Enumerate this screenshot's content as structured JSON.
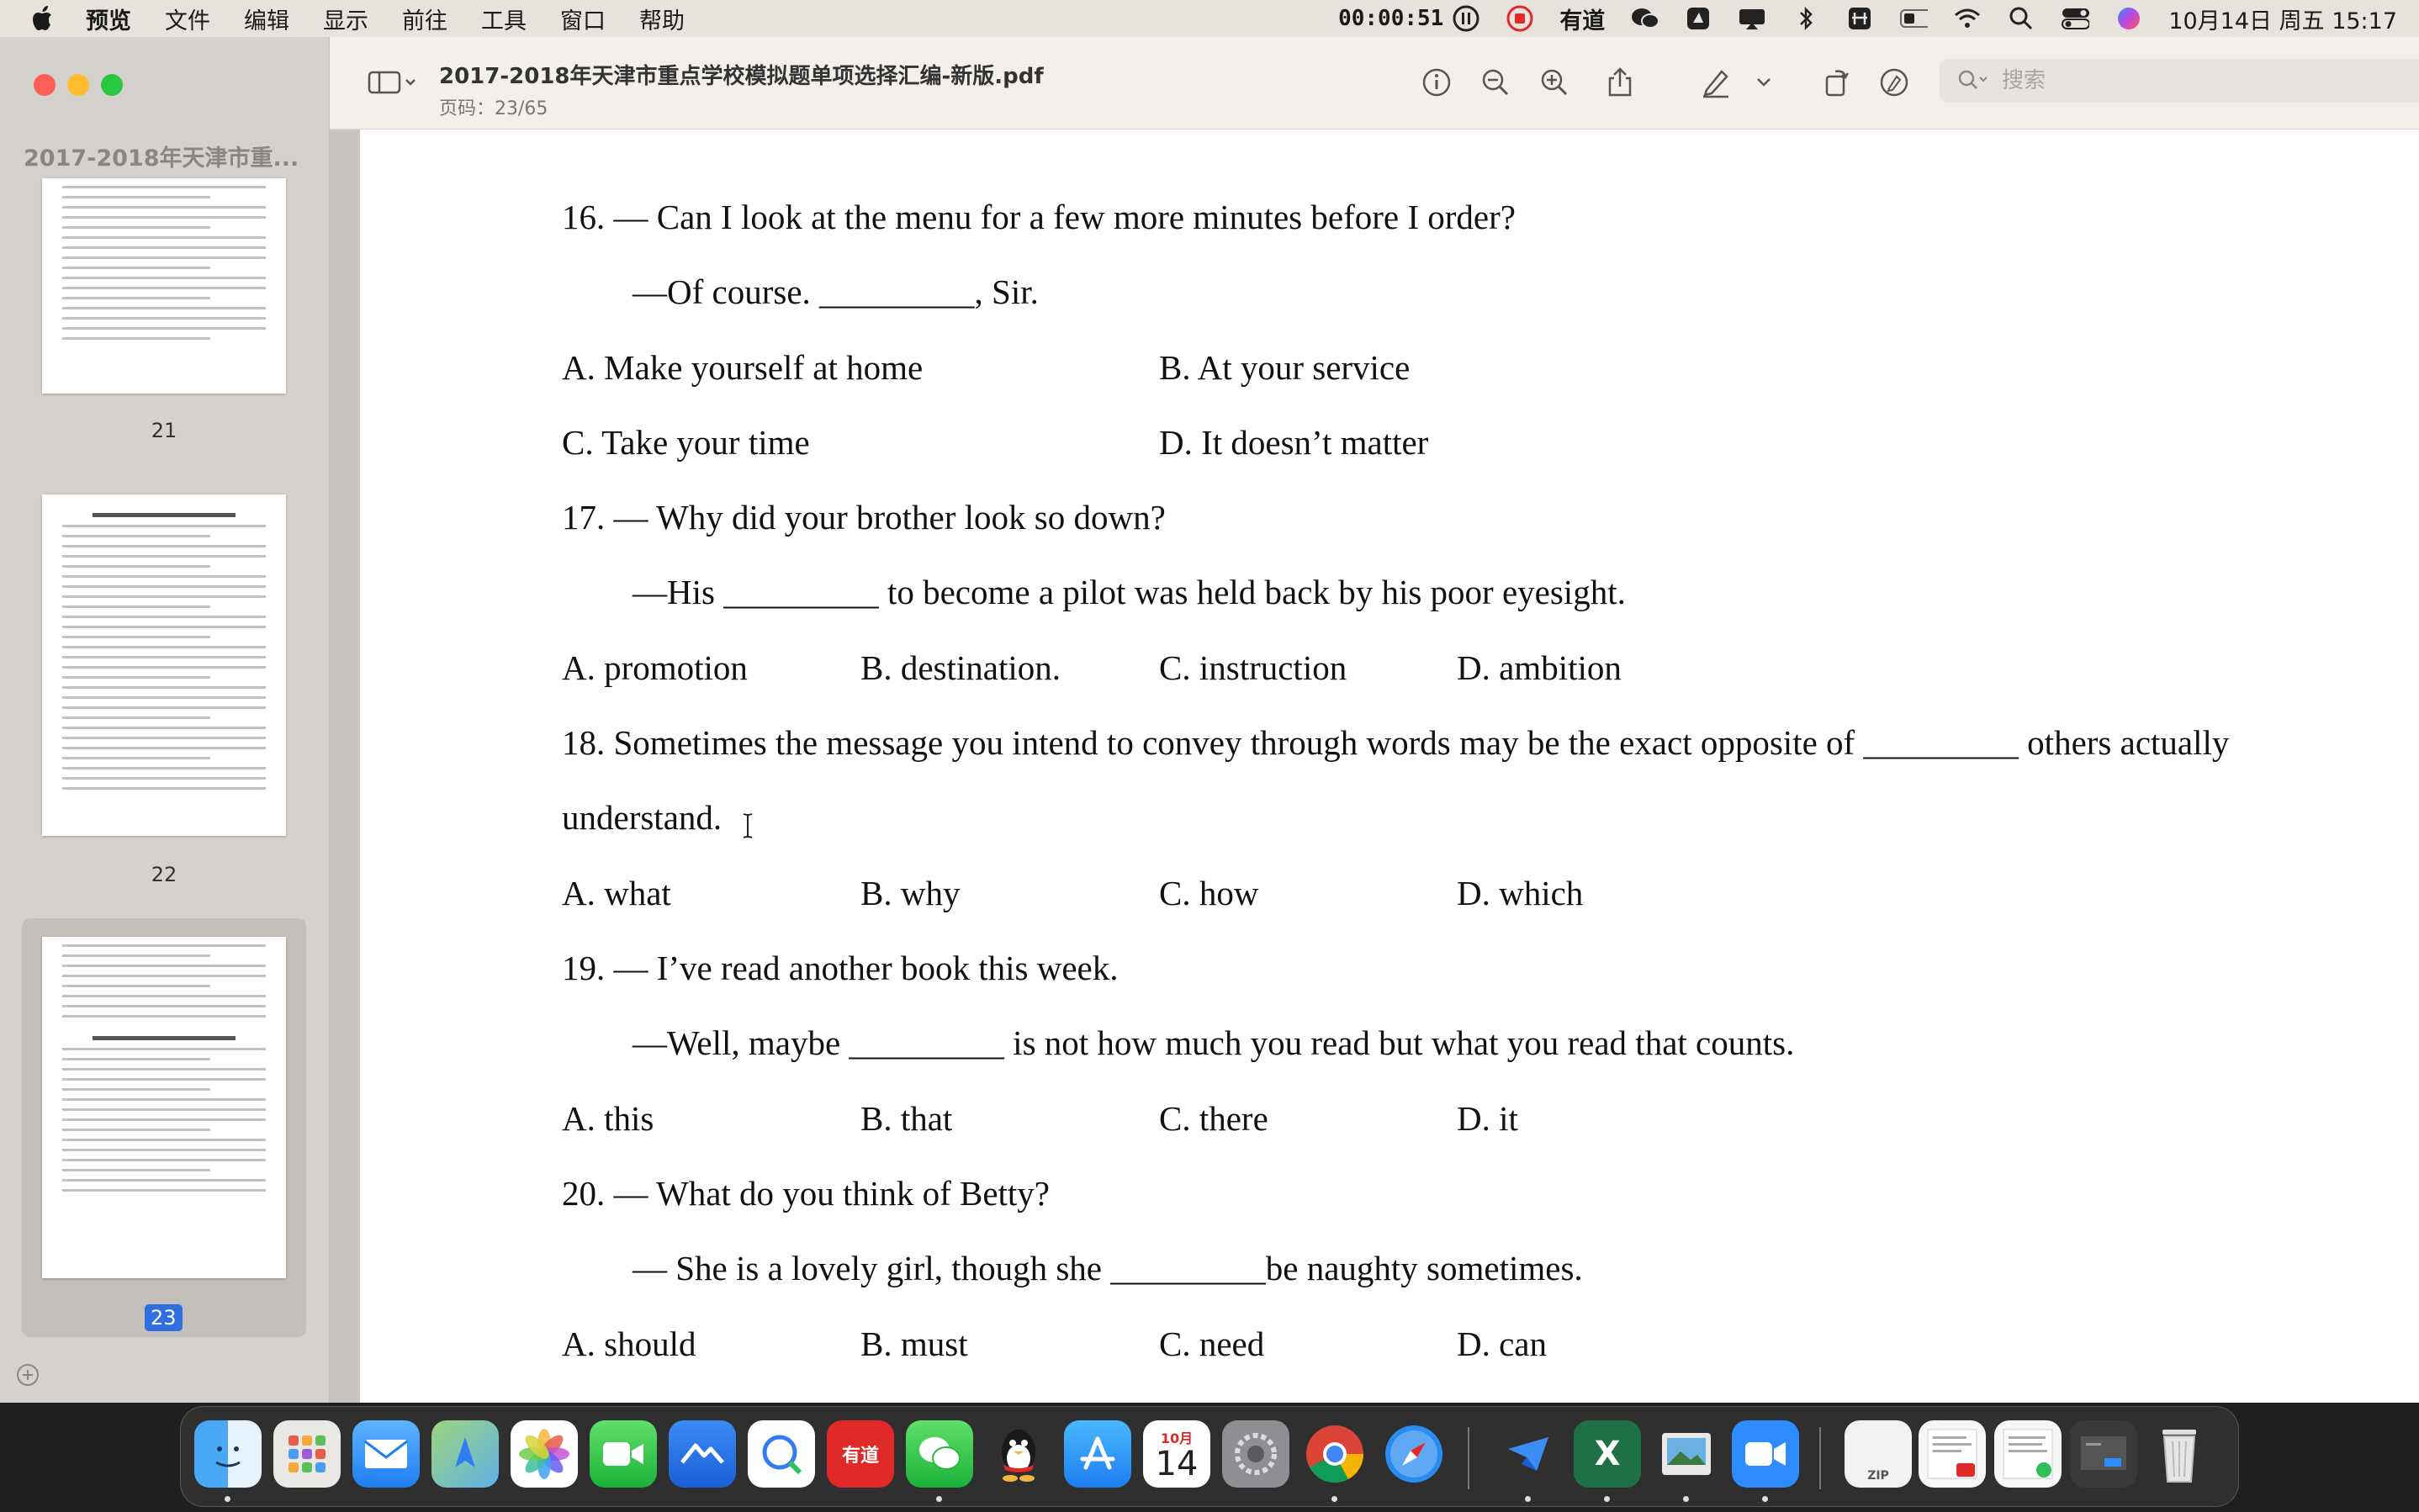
{
  "menubar": {
    "app_name": "预览",
    "items": [
      "文件",
      "编辑",
      "显示",
      "前往",
      "工具",
      "窗口",
      "帮助"
    ],
    "recording_time": "00:00:51",
    "youdao": "有道",
    "datetime": "10月14日 周五  15:17"
  },
  "sidebar": {
    "doc_title": "2017-2018年天津市重...",
    "pages": [
      "21",
      "22",
      "23"
    ],
    "thumb_header_22": "17. 南开中学 2018 届高三年级英语第一次月考试题",
    "thumb_header_23": "18. 天津市耀华中学 2018 届高三上学期第二次月考"
  },
  "toolbar": {
    "title": "2017-2018年天津市重点学校模拟题单项选择汇编-新版.pdf",
    "page_info": "页码：23/65",
    "search_placeholder": "搜索"
  },
  "document": {
    "lines": [
      "16.    — Can I look at the menu for a few more minutes before I order?",
      "—Of course. _________, Sir.",
      "A. Make yourself at home",
      "B. At your service",
      "C. Take your time",
      "D. It doesn’t matter",
      "17.    — Why did your brother look so down?",
      "—His _________ to become a pilot was held back by his poor eyesight.",
      "A. promotion",
      "B. destination.",
      "C. instruction",
      "D. ambition",
      "18. Sometimes the message you intend to convey through words may be the exact opposite of _________ others actually",
      "understand.",
      "A. what",
      "B. why",
      "C. how",
      "D. which",
      "19.    — I’ve read another book this week.",
      "—Well, maybe _________ is not how much you read but what you read that counts.",
      "A. this",
      "B. that",
      "C. there",
      "D. it",
      "20.    — What do you think of Betty?",
      "— She is a lovely girl, though she _________be naughty sometimes.",
      "A. should",
      "B. must",
      "C. need",
      "D. can"
    ]
  },
  "dock": {
    "calendar_month": "10月",
    "calendar_day": "14",
    "youdao_label": "有道",
    "zip_label": "ZIP",
    "excel_label": "X"
  },
  "colors": {
    "close": "#ff5f57",
    "minimize": "#febc2e",
    "zoom": "#28c840",
    "accent": "#2f6fe0",
    "record": "#e0282d"
  }
}
